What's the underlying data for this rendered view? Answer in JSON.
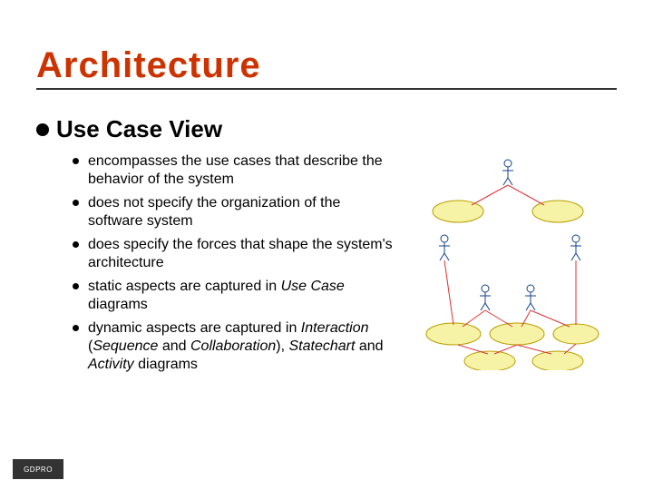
{
  "title": "Architecture",
  "subhead": "Use Case View",
  "bullets": [
    {
      "pre": "encompasses the use cases that describe the behavior of the system"
    },
    {
      "pre": "does not specify the organization of the software system"
    },
    {
      "pre": "does specify the forces that shape the system's architecture"
    },
    {
      "pre": "static aspects are captured in ",
      "em": "Use Case",
      "post": " diagrams"
    },
    {
      "pre": "dynamic aspects are captured in ",
      "em": "Interaction",
      "mid1": " (",
      "em2": "Sequence",
      "mid2": " and ",
      "em3": "Collaboration",
      "mid3": "), ",
      "em4": "Statechart",
      "mid4": " and ",
      "em5": "Activity",
      "post": " diagrams"
    }
  ],
  "footer": "GDPRO"
}
